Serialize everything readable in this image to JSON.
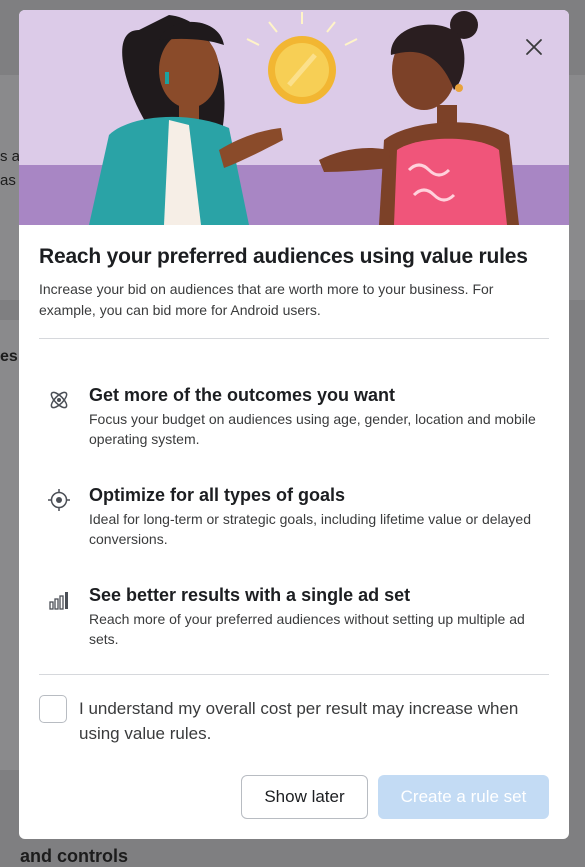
{
  "background": {
    "fragments": [
      "s a",
      "as",
      "es",
      "",
      "and controls"
    ]
  },
  "modal": {
    "close_icon": "close-x-icon",
    "hero_icon": "two-women-coin-illustration",
    "title": "Reach your preferred audiences using value rules",
    "subtitle": "Increase your bid on audiences that are worth more to your business. For example, you can bid more for Android users.",
    "features": [
      {
        "icon": "atom-icon",
        "title": "Get more of the outcomes you want",
        "description": "Focus your budget on audiences using age, gender, location and mobile operating system."
      },
      {
        "icon": "target-icon",
        "title": "Optimize for all types of goals",
        "description": "Ideal for long-term or strategic goals, including lifetime value or delayed conversions."
      },
      {
        "icon": "bar-chart-icon",
        "title": "See better results with a single ad set",
        "description": "Reach more of your preferred audiences without setting up multiple ad sets."
      }
    ],
    "acknowledge": {
      "checked": false,
      "label": "I understand my overall cost per result may increase when using value rules."
    },
    "buttons": {
      "show_later": "Show later",
      "create": "Create a rule set"
    },
    "colors": {
      "hero_bg": "#dccbe8",
      "primary_disabled": "#c3dbf4",
      "coin": "#f5c542"
    }
  }
}
